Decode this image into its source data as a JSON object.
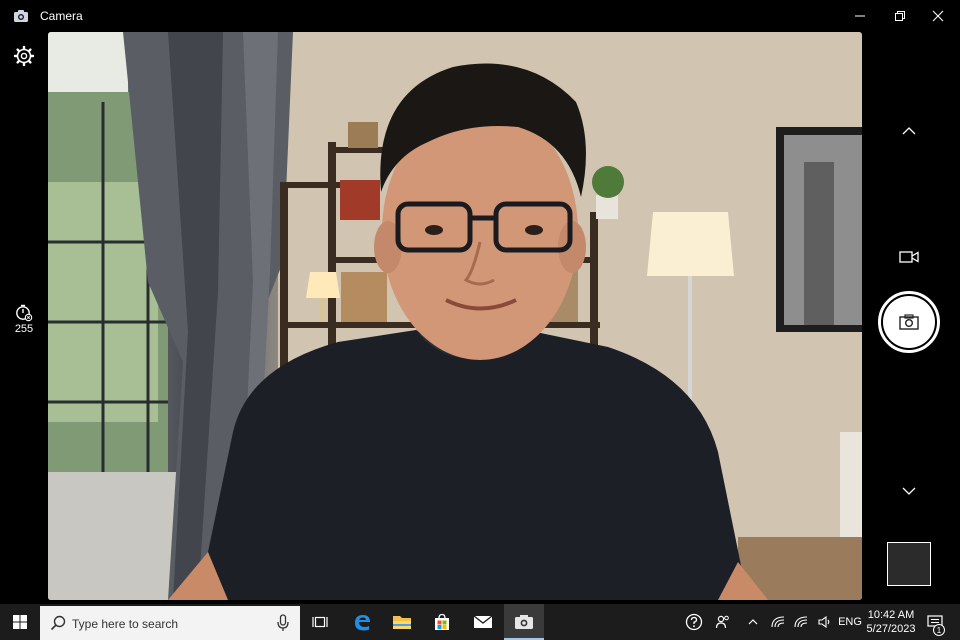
{
  "window": {
    "title": "Camera",
    "app_icon": "camera-icon",
    "controls": [
      "minimize-icon",
      "maximize-icon",
      "close-icon"
    ]
  },
  "left_rail": {
    "settings_icon": "gear-icon",
    "timer_icon": "timer-icon",
    "timer_value": "255"
  },
  "viewfinder": {
    "content": "live camera feed"
  },
  "right_rail": {
    "up_icon": "chevron-up-icon",
    "video_mode_icon": "video-camera-icon",
    "shutter_icon": "camera-icon",
    "down_icon": "chevron-down-icon",
    "thumbnail": "last-capture-thumbnail"
  },
  "taskbar": {
    "start_icon": "windows-logo-icon",
    "search_placeholder": "Type here to search",
    "pinned": [
      {
        "name": "task-view-icon"
      },
      {
        "name": "edge-icon"
      },
      {
        "name": "file-explorer-icon"
      },
      {
        "name": "store-icon"
      },
      {
        "name": "mail-icon"
      },
      {
        "name": "camera-app-icon",
        "active": true
      }
    ],
    "tray": {
      "language": "ENG",
      "time": "10:42 AM",
      "date": "5/27/2023",
      "notification_count": "1"
    }
  },
  "colors": {
    "background": "#000000",
    "taskbar": "#1c1c1c",
    "search_box": "#f3f3f3",
    "active_underline": "#9ec8ee",
    "edge_blue": "#1f8fe6",
    "folder_yellow": "#f0c24b"
  }
}
